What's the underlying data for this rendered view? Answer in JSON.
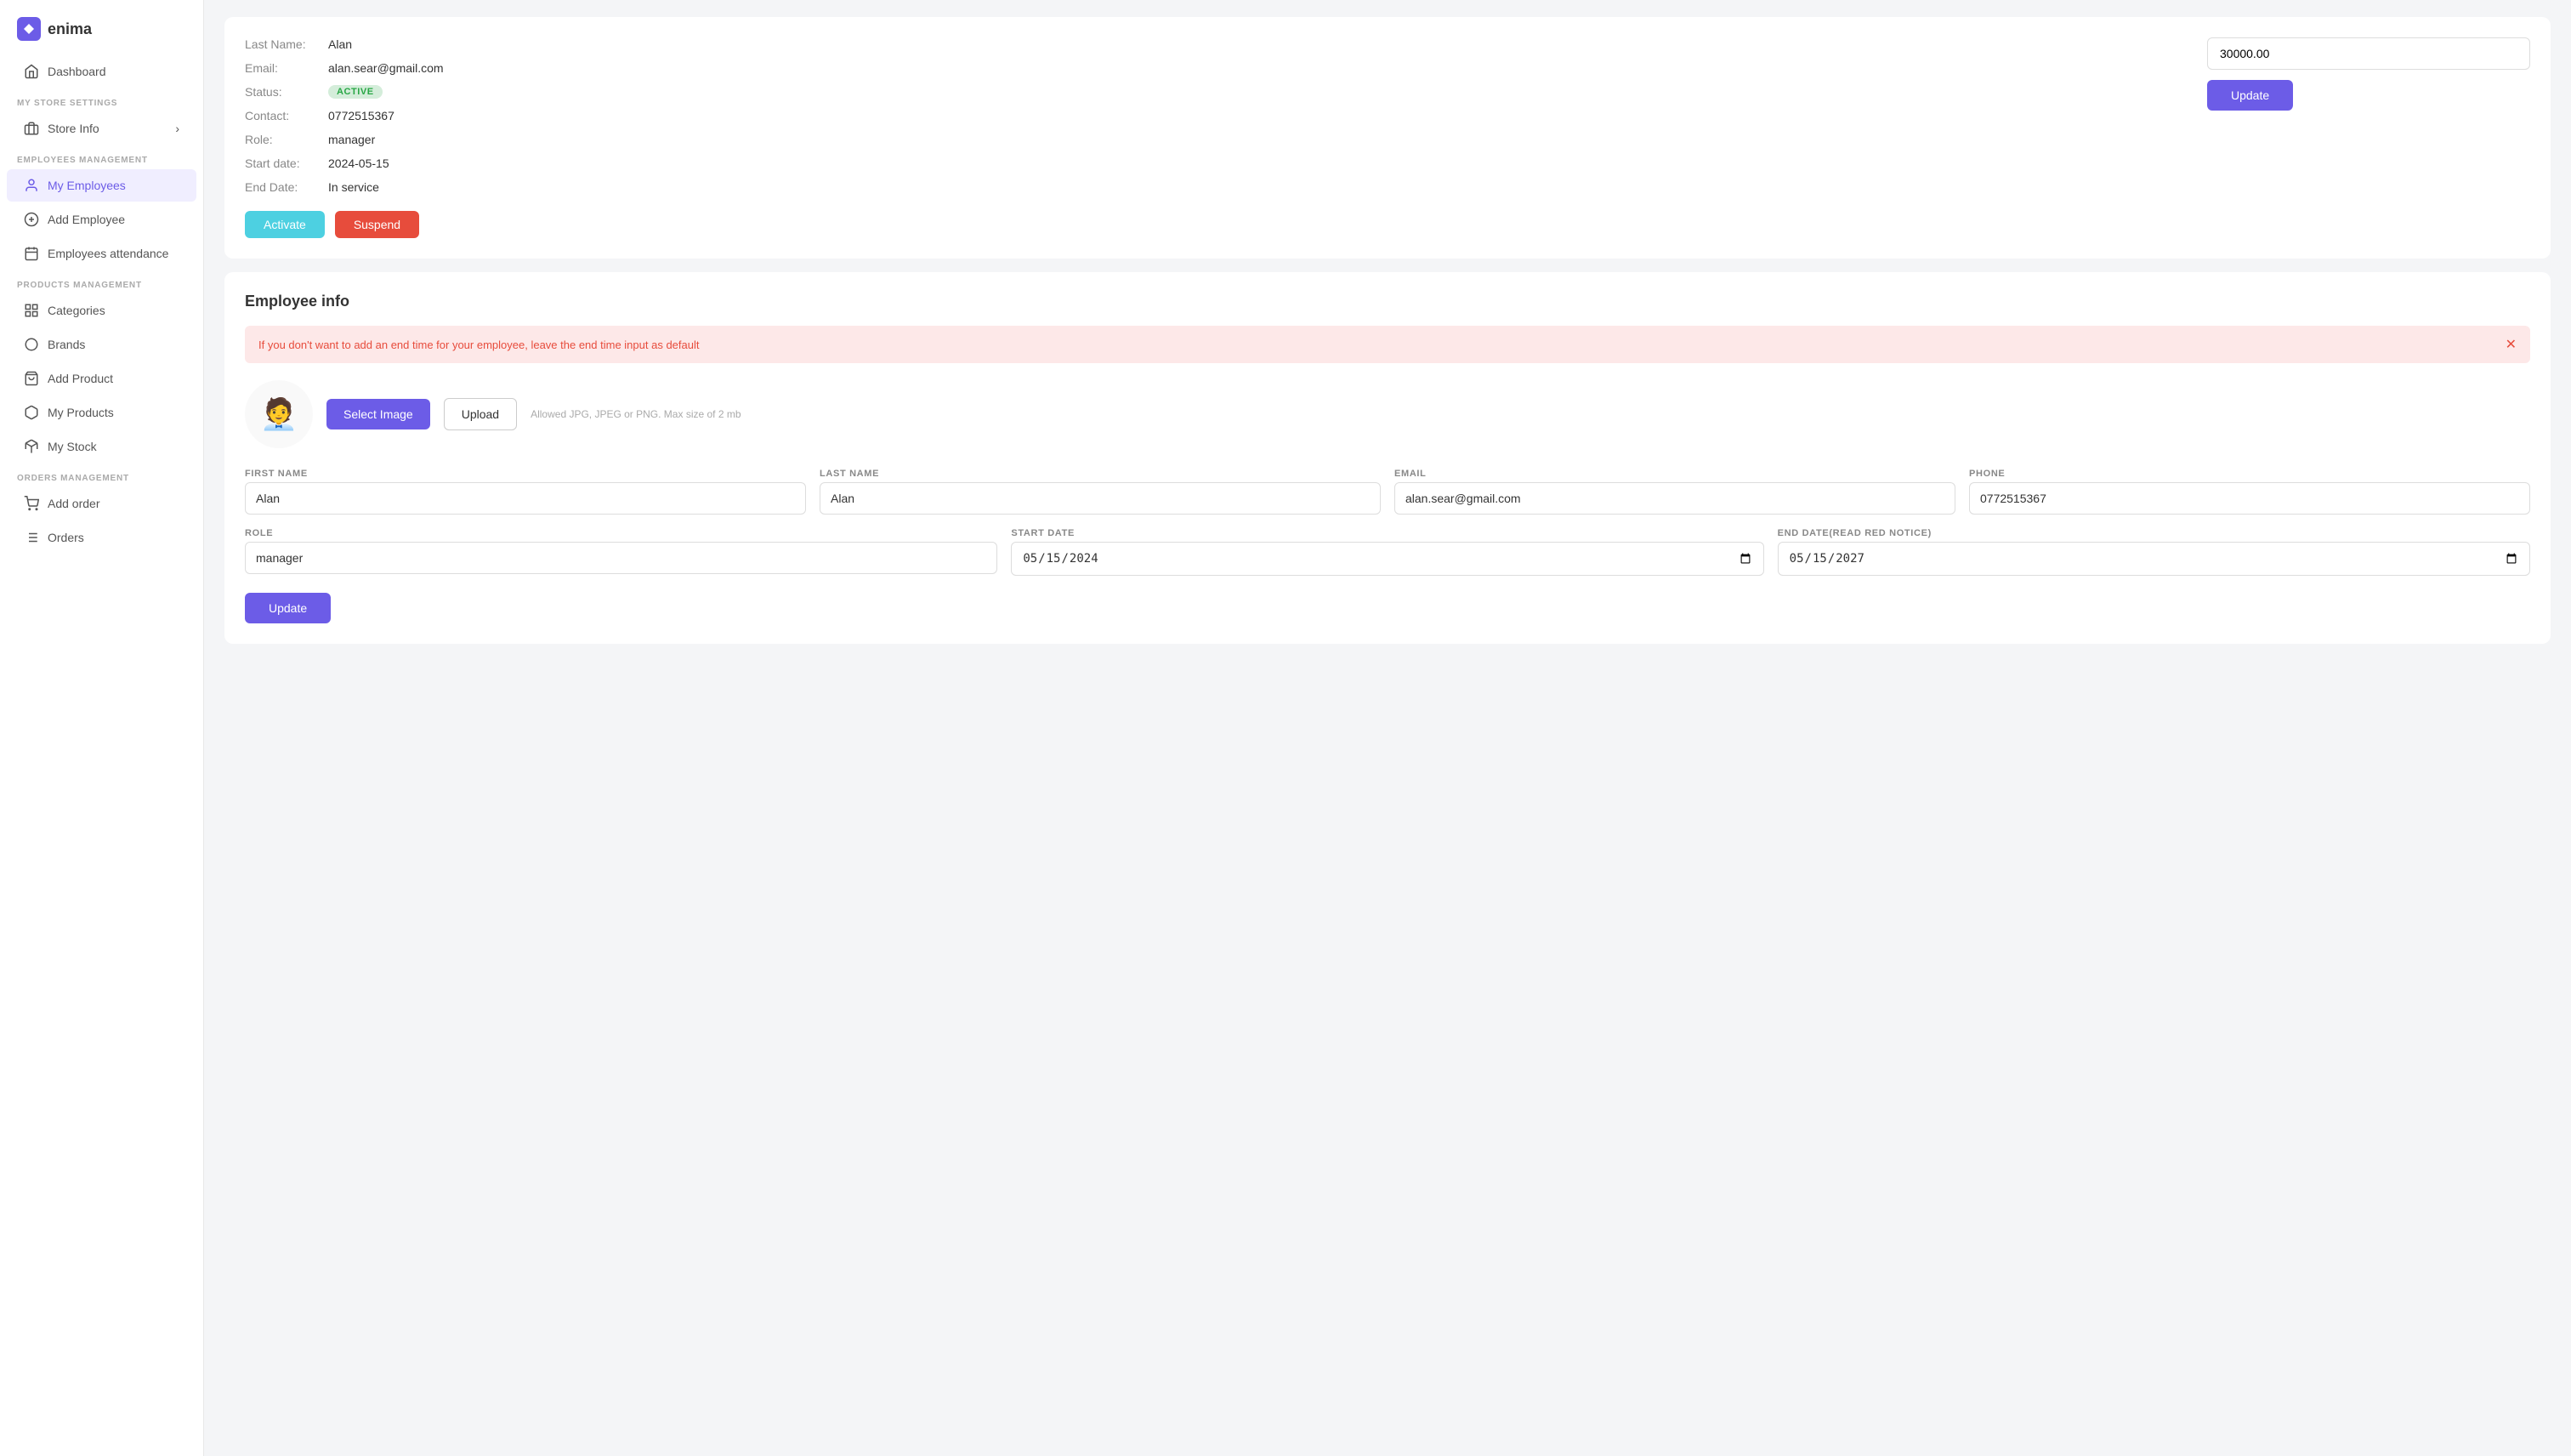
{
  "app": {
    "name": "enima"
  },
  "sidebar": {
    "sections": [
      {
        "items": [
          {
            "id": "dashboard",
            "label": "Dashboard",
            "icon": "home"
          }
        ]
      },
      {
        "label": "MY STORE SETTINGS",
        "items": [
          {
            "id": "store-info",
            "label": "Store Info",
            "icon": "store",
            "arrow": true
          }
        ]
      },
      {
        "label": "EMPLOYEES MANAGEMENT",
        "items": [
          {
            "id": "my-employees",
            "label": "My Employees",
            "icon": "person"
          },
          {
            "id": "add-employee",
            "label": "Add Employee",
            "icon": "add-circle"
          },
          {
            "id": "employees-attendance",
            "label": "Employees attendance",
            "icon": "calendar"
          }
        ]
      },
      {
        "label": "PRODUCTS MANAGEMENT",
        "items": [
          {
            "id": "categories",
            "label": "Categories",
            "icon": "grid"
          },
          {
            "id": "brands",
            "label": "Brands",
            "icon": "circle"
          },
          {
            "id": "add-product",
            "label": "Add Product",
            "icon": "bag"
          },
          {
            "id": "my-products",
            "label": "My Products",
            "icon": "cube"
          },
          {
            "id": "my-stock",
            "label": "My Stock",
            "icon": "box"
          }
        ]
      },
      {
        "label": "ORDERS MANAGEMENT",
        "items": [
          {
            "id": "add-order",
            "label": "Add order",
            "icon": "cart"
          },
          {
            "id": "orders",
            "label": "Orders",
            "icon": "list"
          }
        ]
      }
    ]
  },
  "employee_card": {
    "last_name_label": "Last Name:",
    "last_name_value": "Alan",
    "email_label": "Email:",
    "email_value": "alan.sear@gmail.com",
    "status_label": "Status:",
    "status_value": "ACTIVE",
    "contact_label": "Contact:",
    "contact_value": "0772515367",
    "role_label": "Role:",
    "role_value": "manager",
    "start_date_label": "Start date:",
    "start_date_value": "2024-05-15",
    "end_date_label": "End Date:",
    "end_date_value": "In service",
    "activate_btn": "Activate",
    "suspend_btn": "Suspend",
    "salary_value": "30000.00",
    "update_salary_btn": "Update"
  },
  "employee_info": {
    "section_title": "Employee info",
    "alert_text": "If you don't want to add an end time for your employee, leave the end time input as default",
    "select_image_btn": "Select Image",
    "upload_btn": "Upload",
    "upload_hint": "Allowed JPG, JPEG or PNG. Max size of 2 mb",
    "first_name_label": "FIRST NAME",
    "first_name_value": "Alan",
    "last_name_label": "LAST NAME",
    "last_name_value": "Alan",
    "email_label": "EMAIL",
    "email_value": "alan.sear@gmail.com",
    "phone_label": "PHONE",
    "phone_value": "0772515367",
    "role_label": "ROLE",
    "role_value": "manager",
    "start_date_label": "START DATE",
    "start_date_value": "15/05/2024",
    "end_date_label": "END DATE(READ RED NOTICE)",
    "end_date_value": "15/05/2027",
    "update_btn": "Update"
  }
}
